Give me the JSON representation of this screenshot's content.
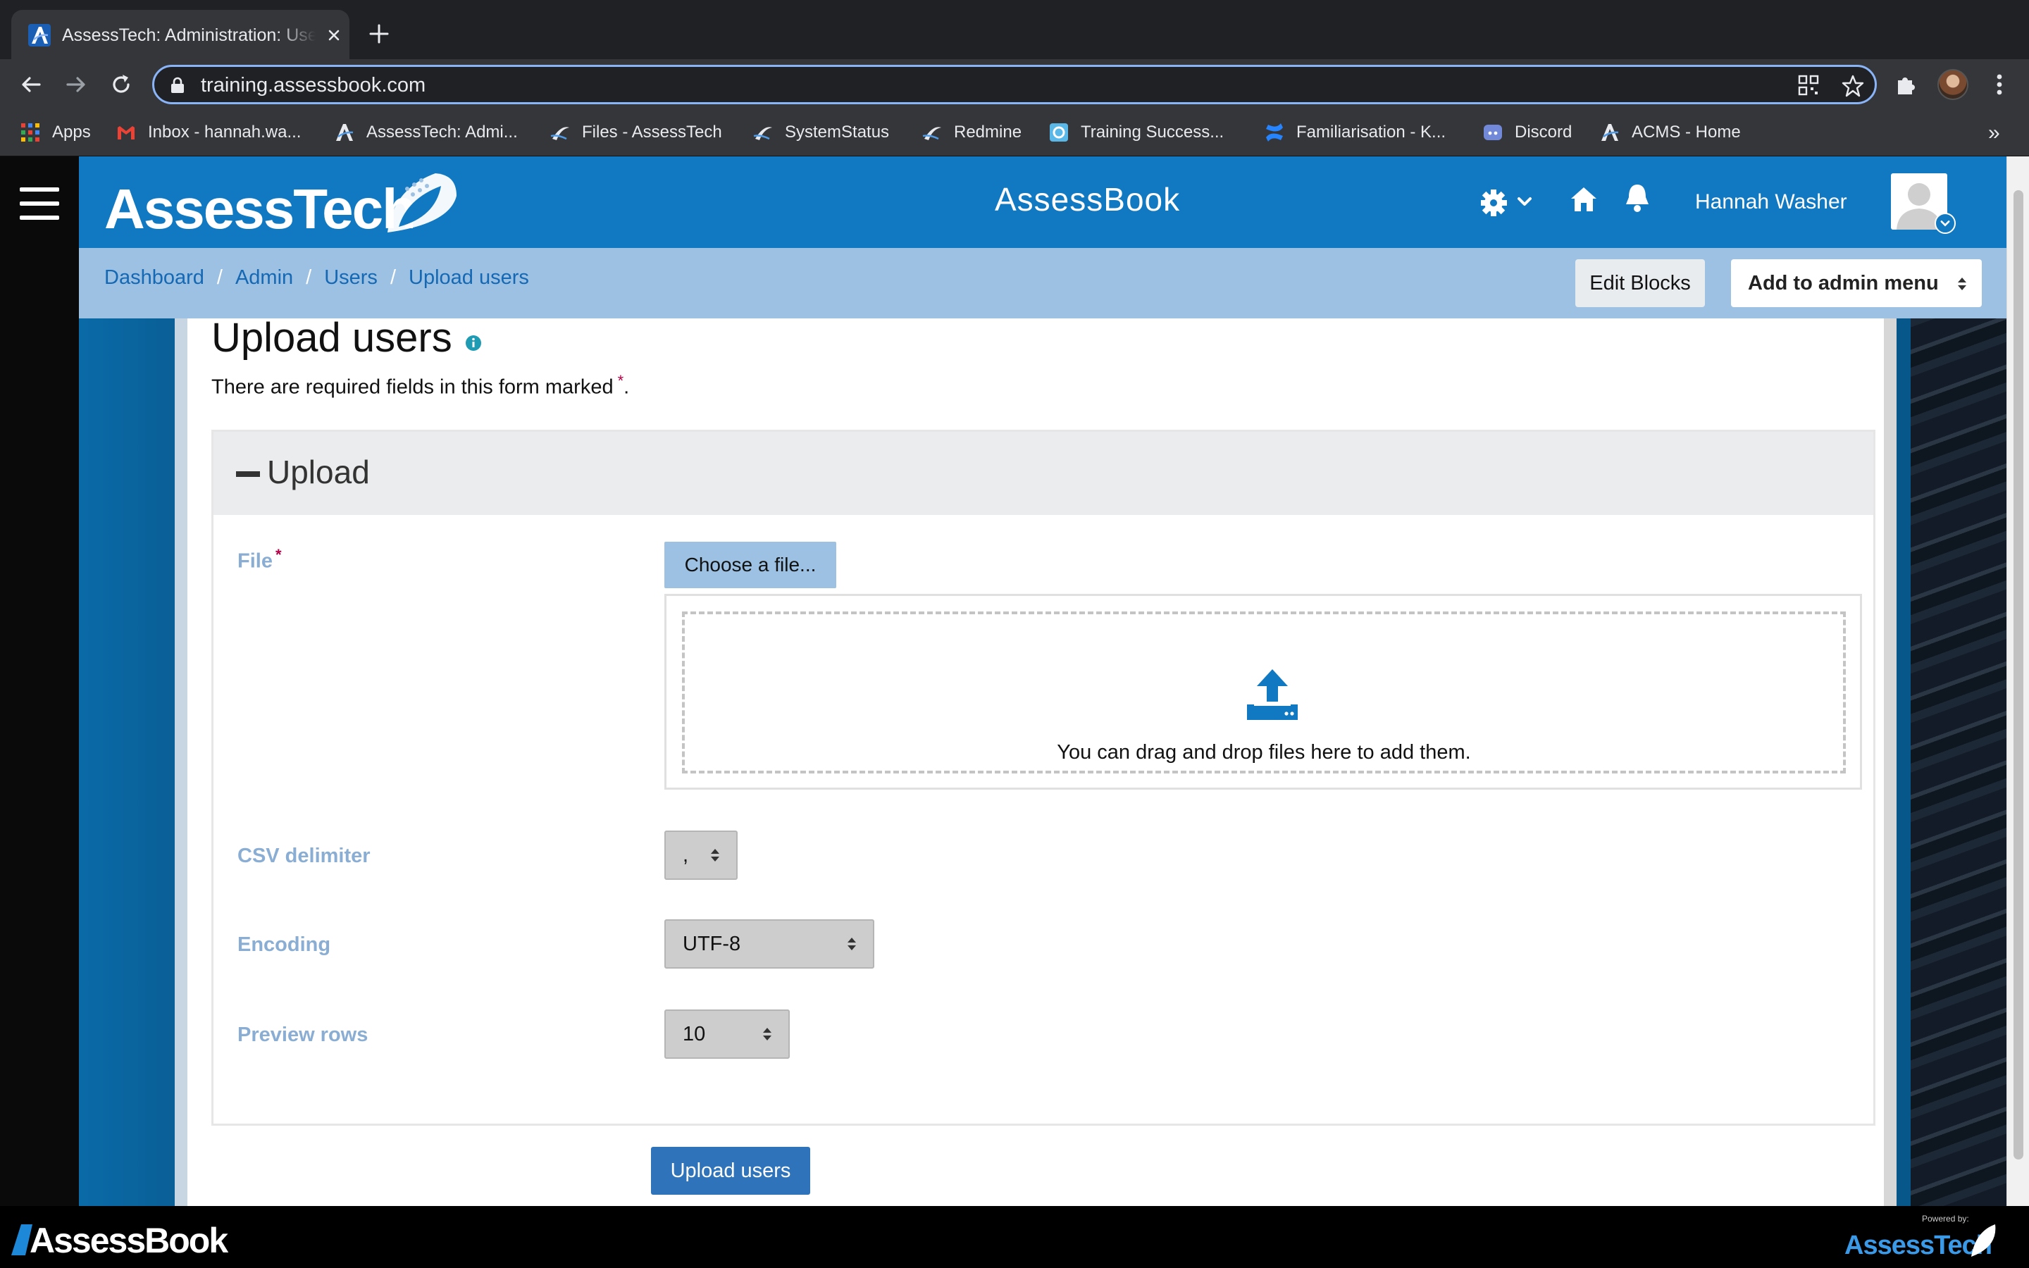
{
  "browser": {
    "tab_title": "AssessTech: Administration: Users",
    "url": "training.assessbook.com",
    "bookmarks": [
      {
        "label": "Apps",
        "icon": "apps-grid-icon"
      },
      {
        "label": "Inbox - hannah.wa...",
        "icon": "gmail-icon"
      },
      {
        "label": "AssessTech: Admi...",
        "icon": "assesstech-icon"
      },
      {
        "label": "Files - AssessTech",
        "icon": "assesstech-swoosh-icon"
      },
      {
        "label": "SystemStatus",
        "icon": "assesstech-swoosh-icon"
      },
      {
        "label": "Redmine",
        "icon": "assesstech-swoosh-icon"
      },
      {
        "label": "Training Success...",
        "icon": "training-icon"
      },
      {
        "label": "Familiarisation - K...",
        "icon": "confluence-icon"
      },
      {
        "label": "Discord",
        "icon": "discord-icon"
      },
      {
        "label": "ACMS - Home",
        "icon": "assesstech-icon"
      }
    ],
    "more_bookmarks": "»"
  },
  "header": {
    "logo_text": "AssessTech",
    "site_title": "AssessBook",
    "user_name": "Hannah Washer"
  },
  "breadcrumbs": [
    "Dashboard",
    "Admin",
    "Users",
    "Upload users"
  ],
  "actions": {
    "edit_blocks": "Edit Blocks",
    "add_to_admin_menu": "Add to admin menu"
  },
  "page": {
    "title": "Upload users",
    "required_note": "There are required fields in this form marked",
    "required_marker": "*",
    "required_note_end": "."
  },
  "form": {
    "section_title": "Upload",
    "file": {
      "label": "File",
      "choose_button": "Choose a file...",
      "drop_text": "You can drag and drop files here to add them."
    },
    "csv_delimiter": {
      "label": "CSV delimiter",
      "value": ","
    },
    "encoding": {
      "label": "Encoding",
      "value": "UTF-8"
    },
    "preview_rows": {
      "label": "Preview rows",
      "value": "10"
    },
    "submit": "Upload users"
  },
  "footer": {
    "left_logo": "AssessBook",
    "right_caption": "Powered by:",
    "right_logo": "AssessTech"
  },
  "colors": {
    "header_blue": "#1178c2",
    "breadcrumb_bar": "#9dc1e3",
    "link_blue": "#1568b3",
    "primary_button": "#2f73ba",
    "label_muted": "#8aaed3",
    "required_red": "#b30047"
  }
}
